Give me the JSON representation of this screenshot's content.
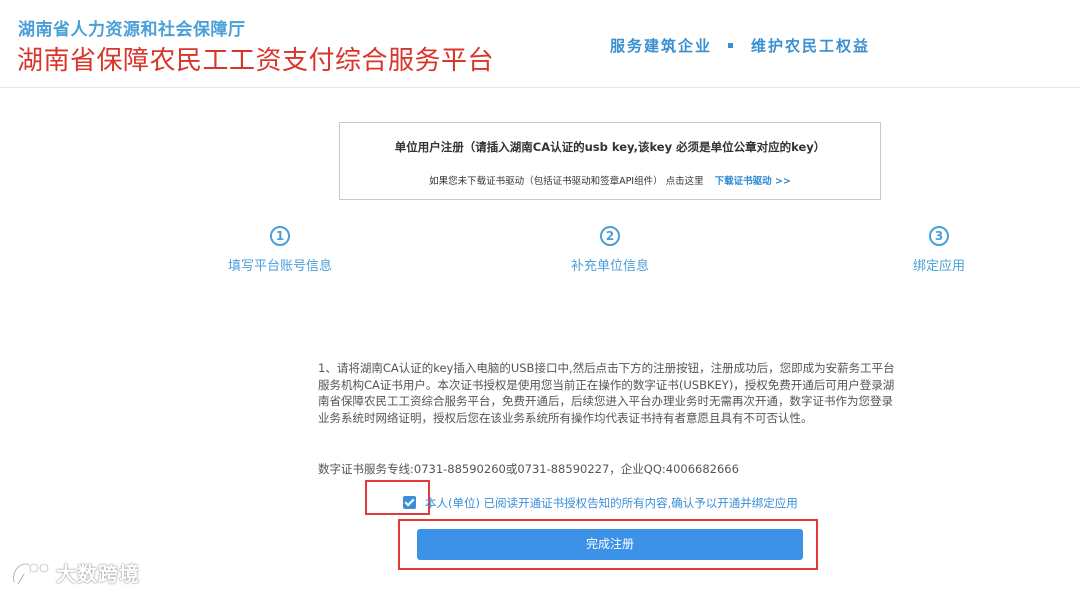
{
  "header": {
    "org_name": "湖南省人力资源和社会保障厅",
    "platform_title": "湖南省保障农民工工资支付综合服务平台",
    "slogan_left": "服务建筑企业",
    "slogan_right": "维护农民工权益"
  },
  "notice": {
    "title": "单位用户注册（请插入湖南CA认证的usb key,该key 必须是单位公章对应的key）",
    "sub_text": "如果您未下载证书驱动（包括证书驱动和签章API组件） 点击这里",
    "download_link": "下载证书驱动 >>"
  },
  "steps": [
    {
      "number": "1",
      "label": "填写平台账号信息"
    },
    {
      "number": "2",
      "label": "补充单位信息"
    },
    {
      "number": "3",
      "label": "绑定应用"
    }
  ],
  "agreement_text": "1、请将湖南CA认证的key插入电脑的USB接口中,然后点击下方的注册按钮，注册成功后，您即成为安薪务工平台服务机构CA证书用户。本次证书授权是使用您当前正在操作的数字证书(USBKEY)，授权免费开通后可用户登录湖南省保障农民工工资综合服务平台，免费开通后，后续您进入平台办理业务时无需再次开通，数字证书作为您登录业务系统时网络证明，授权后您在该业务系统所有操作均代表证书持有者意愿且具有不可否认性。",
  "hotline": "数字证书服务专线:0731-88590260或0731-88590227，企业QQ:4006682666",
  "consent": {
    "checked": true,
    "label": "本人(单位) 已阅读开通证书授权告知的所有内容,确认予以开通并绑定应用"
  },
  "submit_label": "完成注册",
  "watermark": {
    "text": "大数跨境"
  },
  "colors": {
    "title_red": "#d9352a",
    "accent_blue": "#4a9fd8",
    "button_blue": "#3c92e6",
    "highlight_red": "#e23a36"
  }
}
